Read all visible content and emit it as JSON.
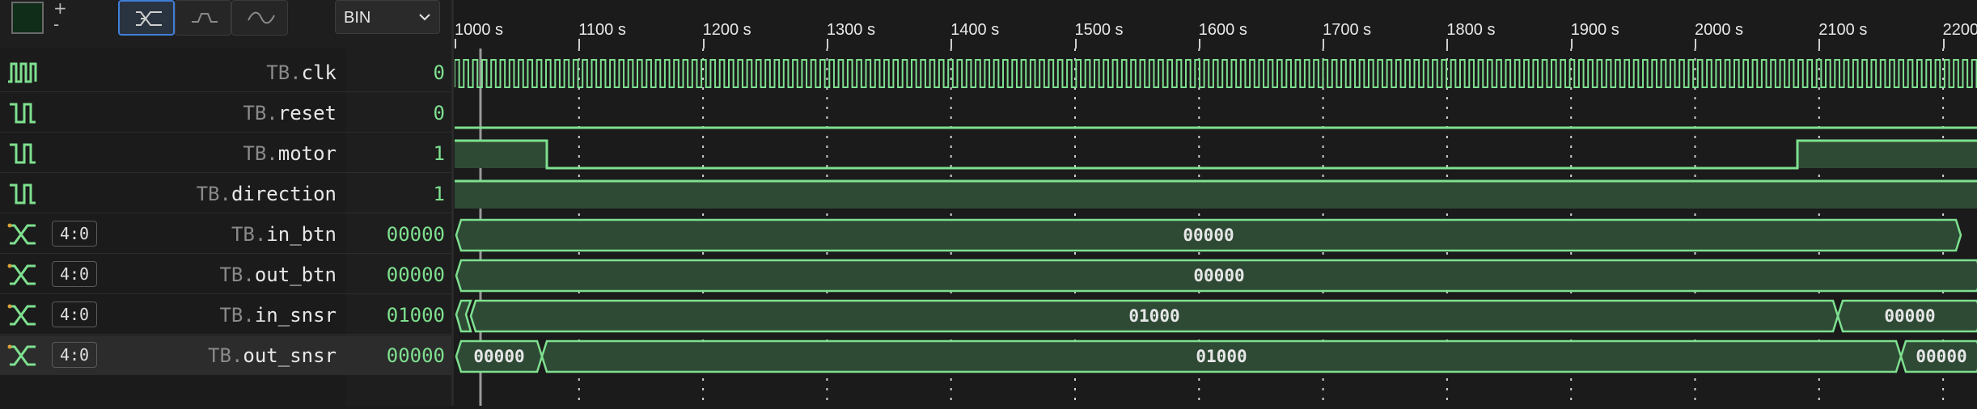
{
  "toolbar": {
    "plus": "+",
    "minus": "-",
    "format_select": "BIN",
    "modes": [
      "bus-icon",
      "step-icon",
      "analog-icon"
    ]
  },
  "ruler": {
    "ticks": [
      "1000 s",
      "1100 s",
      "1200 s",
      "1300 s",
      "1400 s",
      "1500 s",
      "1600 s",
      "1700 s",
      "1800 s",
      "1900 s",
      "2000 s",
      "2100 s",
      "2200"
    ]
  },
  "signals": [
    {
      "scope": "TB.",
      "name": "clk",
      "value": "0",
      "kind": "clock",
      "range": ""
    },
    {
      "scope": "TB.",
      "name": "reset",
      "value": "0",
      "kind": "bit",
      "range": ""
    },
    {
      "scope": "TB.",
      "name": "motor",
      "value": "1",
      "kind": "bit",
      "range": ""
    },
    {
      "scope": "TB.",
      "name": "direction",
      "value": "1",
      "kind": "bit",
      "range": ""
    },
    {
      "scope": "TB.",
      "name": "in_btn",
      "value": "00000",
      "kind": "bus",
      "range": "4:0"
    },
    {
      "scope": "TB.",
      "name": "out_btn",
      "value": "00000",
      "kind": "bus",
      "range": "4:0"
    },
    {
      "scope": "TB.",
      "name": "in_snsr",
      "value": "01000",
      "kind": "bus",
      "range": "4:0"
    },
    {
      "scope": "TB.",
      "name": "out_snsr",
      "value": "00000",
      "kind": "bus",
      "range": "4:0"
    }
  ],
  "waves": {
    "in_btn": [
      "00000"
    ],
    "out_btn": [
      "00000"
    ],
    "in_snsr": [
      "01000",
      "00000"
    ],
    "out_snsr": [
      "00000",
      "01000",
      "00000"
    ]
  },
  "colors": {
    "wave": "#7ee08f",
    "fill": "#2e4a35",
    "bg": "#1b1b1b",
    "grid": "#cfcfcf"
  }
}
